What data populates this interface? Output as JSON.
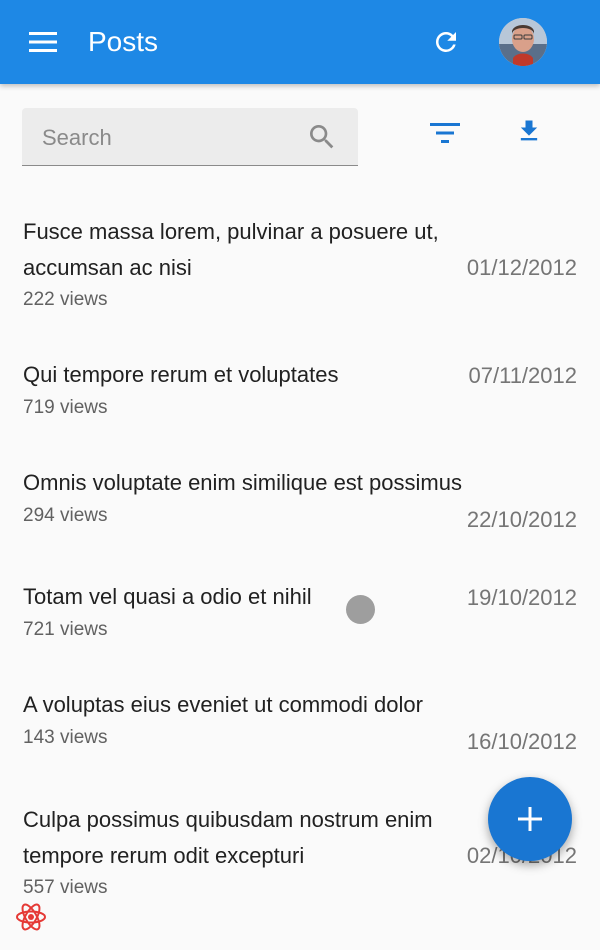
{
  "appbar": {
    "title": "Posts",
    "menu_icon": "menu-icon",
    "refresh_icon": "refresh-icon",
    "avatar": "avatar",
    "color": "#1e88e5"
  },
  "toolbar": {
    "search_placeholder": "Search",
    "search_icon": "search-icon",
    "filter_icon": "filter-icon",
    "download_icon": "download-icon"
  },
  "posts": [
    {
      "title": "Fusce massa lorem, pulvinar a posuere ut, accumsan ac nisi",
      "views": "222 views",
      "date": "01/12/2012"
    },
    {
      "title": "Qui tempore rerum et voluptates",
      "views": "719 views",
      "date": "07/11/2012"
    },
    {
      "title": "Omnis voluptate enim similique est possimus",
      "views": "294 views",
      "date": "22/10/2012"
    },
    {
      "title": "Totam vel quasi a odio et nihil",
      "views": "721 views",
      "date": "19/10/2012"
    },
    {
      "title": "A voluptas eius eveniet ut commodi dolor",
      "views": "143 views",
      "date": "16/10/2012"
    },
    {
      "title": "Culpa possimus quibusdam nostrum enim tempore rerum odit excepturi",
      "views": "557 views",
      "date": "02/10/2012"
    }
  ],
  "fab": {
    "icon": "plus-icon",
    "color": "#1976d2"
  },
  "footer": {
    "logo_icon": "react-logo-icon"
  }
}
